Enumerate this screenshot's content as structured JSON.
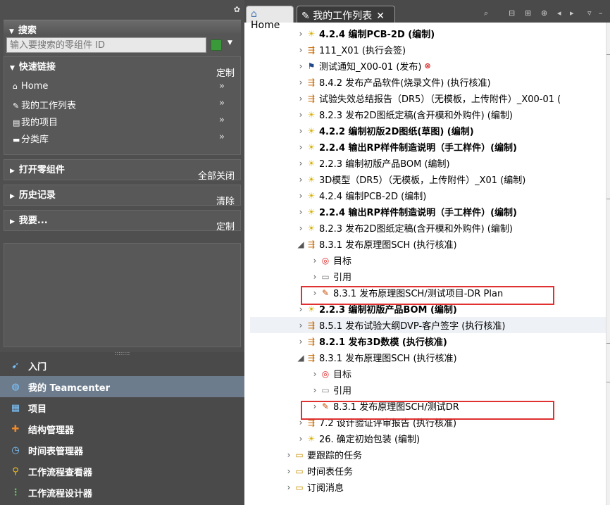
{
  "left": {
    "search": {
      "title": "搜索",
      "placeholder": "输入要搜索的零组件 ID"
    },
    "quick_links": {
      "title": "快速链接",
      "action": "定制",
      "items": [
        {
          "label": "Home",
          "icon": "home-icon"
        },
        {
          "label": "我的工作列表",
          "icon": "worklist-icon"
        },
        {
          "label": "我的项目",
          "icon": "project-icon"
        },
        {
          "label": "分类库",
          "icon": "folder-icon"
        }
      ]
    },
    "open_items": {
      "title": "打开零组件",
      "action": "全部关闭"
    },
    "history": {
      "title": "历史记录",
      "action": "清除"
    },
    "i_want": {
      "title": "我要...",
      "action": "定制"
    },
    "nav": [
      {
        "label": "入门",
        "icon": "getting-started-icon"
      },
      {
        "label": "我的 Teamcenter",
        "icon": "globe-icon",
        "selected": true
      },
      {
        "label": "项目",
        "icon": "project-icon"
      },
      {
        "label": "结构管理器",
        "icon": "structure-icon"
      },
      {
        "label": "时间表管理器",
        "icon": "schedule-icon"
      },
      {
        "label": "工作流程查看器",
        "icon": "workflow-viewer-icon"
      },
      {
        "label": "工作流程设计器",
        "icon": "workflow-designer-icon"
      }
    ]
  },
  "tabs": {
    "home": "Home",
    "worklist": "我的工作列表"
  },
  "tree": [
    {
      "level": 1,
      "icon": "star",
      "label": "4.2.4 编制PCB-2D (编制)",
      "bold": true
    },
    {
      "level": 1,
      "icon": "flow",
      "label": "111_X01 (执行会签)"
    },
    {
      "level": 1,
      "icon": "flag",
      "label": "测试通知_X00-01 (发布)",
      "error": true
    },
    {
      "level": 1,
      "icon": "flow",
      "label": "8.4.2 发布产品软件(烧录文件) (执行核准)"
    },
    {
      "level": 1,
      "icon": "flow",
      "label": "试验失效总结报告（DR5）（无模板，上传附件）_X00-01 ("
    },
    {
      "level": 1,
      "icon": "star",
      "label": "8.2.3 发布2D图纸定稿(含开模和外购件) (编制)"
    },
    {
      "level": 1,
      "icon": "star",
      "label": "4.2.2 编制初版2D图纸(草图) (编制)",
      "bold": true
    },
    {
      "level": 1,
      "icon": "star",
      "label": "2.2.4 输出RP样件制造说明（手工样件）(编制)",
      "bold": true
    },
    {
      "level": 1,
      "icon": "star",
      "label": "2.2.3 编制初版产品BOM (编制)"
    },
    {
      "level": 1,
      "icon": "star",
      "label": "3D模型（DR5）（无模板，上传附件）_X01 (编制)"
    },
    {
      "level": 1,
      "icon": "star",
      "label": "4.2.4 编制PCB-2D (编制)"
    },
    {
      "level": 1,
      "icon": "star",
      "label": "2.2.4 输出RP样件制造说明（手工样件）(编制)",
      "bold": true
    },
    {
      "level": 1,
      "icon": "star",
      "label": "8.2.3 发布2D图纸定稿(含开模和外购件) (编制)"
    },
    {
      "level": 1,
      "icon": "flow",
      "label": "8.3.1 发布原理图SCH (执行核准)",
      "expanded": true
    },
    {
      "level": 2,
      "icon": "target",
      "label": "目标"
    },
    {
      "level": 2,
      "icon": "ref",
      "label": "引用"
    },
    {
      "level": 2,
      "icon": "proj",
      "label": "8.3.1 发布原理图SCH/测试项目-DR Plan",
      "boxed": true
    },
    {
      "level": 1,
      "icon": "star",
      "label": "2.2.3 编制初版产品BOM (编制)",
      "bold": true
    },
    {
      "level": 1,
      "icon": "flow",
      "label": "8.5.1 发布试验大纲DVP-客户签字 (执行核准)",
      "highlight": true
    },
    {
      "level": 1,
      "icon": "flow",
      "label": "8.2.1 发布3D数模 (执行核准)",
      "bold": true
    },
    {
      "level": 1,
      "icon": "flow",
      "label": "8.3.1 发布原理图SCH (执行核准)",
      "expanded": true
    },
    {
      "level": 2,
      "icon": "target",
      "label": "目标"
    },
    {
      "level": 2,
      "icon": "ref",
      "label": "引用"
    },
    {
      "level": 2,
      "icon": "proj",
      "label": "8.3.1 发布原理图SCH/测试DR",
      "boxed": true
    },
    {
      "level": 1,
      "icon": "flow",
      "label": "7.2 设计验证评审报告 (执行核准)"
    },
    {
      "level": 1,
      "icon": "star",
      "label": "26. 确定初始包装 (编制)"
    },
    {
      "level": 0,
      "icon": "folder",
      "label": "要跟踪的任务"
    },
    {
      "level": 0,
      "icon": "folder",
      "label": "时间表任务"
    },
    {
      "level": 0,
      "icon": "folder",
      "label": "订阅消息"
    }
  ]
}
